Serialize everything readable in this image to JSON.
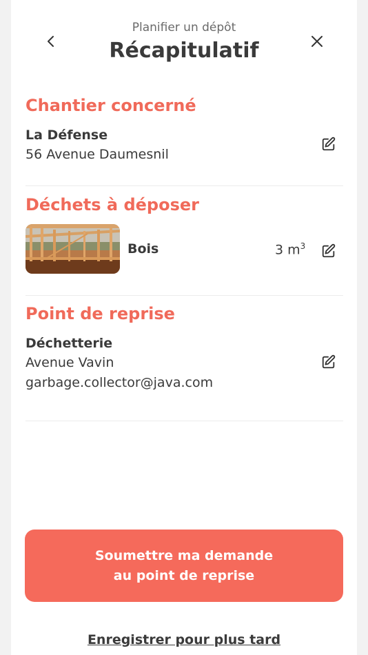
{
  "header": {
    "subtitle": "Planifier un dépôt",
    "title": "Récapitulatif",
    "back_icon": "chevron-left-icon",
    "close_icon": "close-icon"
  },
  "site": {
    "section_title": "Chantier concerné",
    "name": "La Défense",
    "address": "56 Avenue Daumesnil",
    "edit_icon": "edit-icon"
  },
  "waste": {
    "section_title": "Déchets à déposer",
    "item_name": "Bois",
    "quantity_value": "3 m",
    "quantity_unit_exp": "3",
    "edit_icon": "edit-icon"
  },
  "pickup": {
    "section_title": "Point de reprise",
    "name": "Déchetterie",
    "address": "Avenue Vavin",
    "email": "garbage.collector@java.com",
    "edit_icon": "edit-icon"
  },
  "actions": {
    "submit_line1": "Soumettre ma demande",
    "submit_line2": "au point de reprise",
    "save_later": "Enregistrer pour plus tard"
  },
  "colors": {
    "accent": "#f56a5b",
    "section_title": "#f06a5a",
    "text": "#3a3a3a"
  }
}
